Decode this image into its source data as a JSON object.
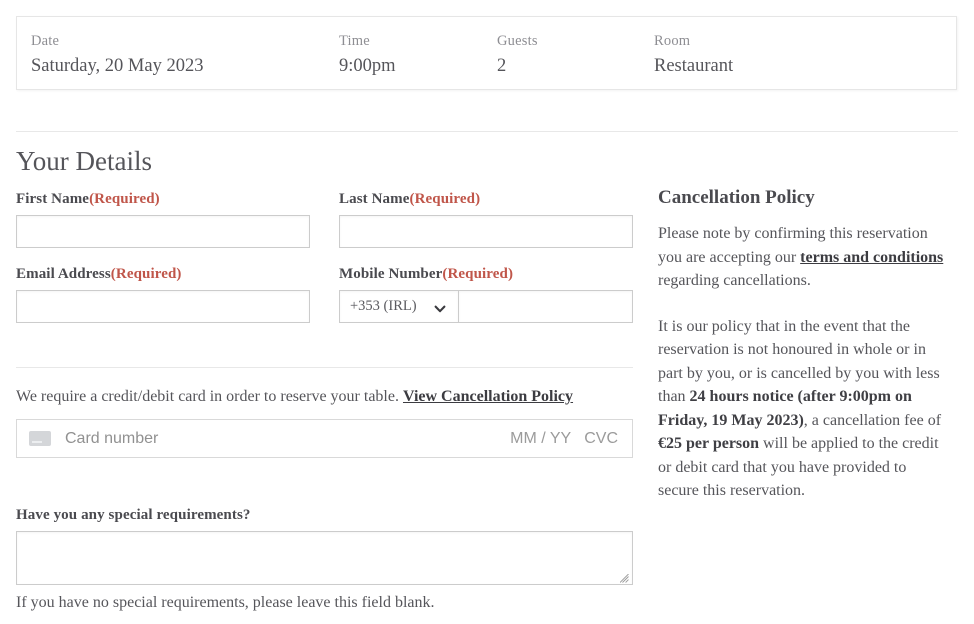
{
  "summary": {
    "items": [
      {
        "label": "Date",
        "value": "Saturday, 20 May 2023"
      },
      {
        "label": "Time",
        "value": "9:00pm"
      },
      {
        "label": "Guests",
        "value": "2"
      },
      {
        "label": "Room",
        "value": "Restaurant"
      }
    ]
  },
  "form": {
    "section_title": "Your Details",
    "required_tag": "(Required)",
    "first_name": {
      "label": "First Name",
      "value": "",
      "placeholder": ""
    },
    "last_name": {
      "label": "Last Name",
      "value": "",
      "placeholder": ""
    },
    "email": {
      "label": "Email Address",
      "value": "",
      "placeholder": ""
    },
    "mobile": {
      "label": "Mobile Number",
      "country_code": "+353 (IRL)",
      "value": "",
      "placeholder": ""
    }
  },
  "payment": {
    "intro_text": "We require a credit/debit card in order to reserve your table.",
    "policy_link": "View Cancellation Policy",
    "card_number_placeholder": "Card number",
    "expiry_placeholder": "MM / YY",
    "cvc_placeholder": "CVC",
    "card_icon": "credit-card-icon"
  },
  "special_requirements": {
    "label": "Have you any special requirements?",
    "value": "",
    "placeholder": "",
    "hint": "If you have no special requirements, please leave this field blank."
  },
  "cancellation_policy": {
    "title": "Cancellation Policy",
    "paragraph1_before": "Please note by confirming this reservation you are accepting our ",
    "terms_link": "terms and conditions",
    "paragraph1_after": " regarding cancellations.",
    "paragraph2_part1": "It is our policy that in the event that the reservation is not honoured in whole or in part by you, or is cancelled by you with less than ",
    "paragraph2_bold1": "24 hours notice (after 9:00pm on Friday, 19 May 2023)",
    "paragraph2_part2": ", a cancellation fee of ",
    "paragraph2_bold2": "€25 per person",
    "paragraph2_part3": " will be applied to the credit or debit card that you have provided to secure this reservation."
  },
  "colors": {
    "required_red": "#c0564a",
    "text": "#55555a",
    "border": "#cccccc"
  }
}
